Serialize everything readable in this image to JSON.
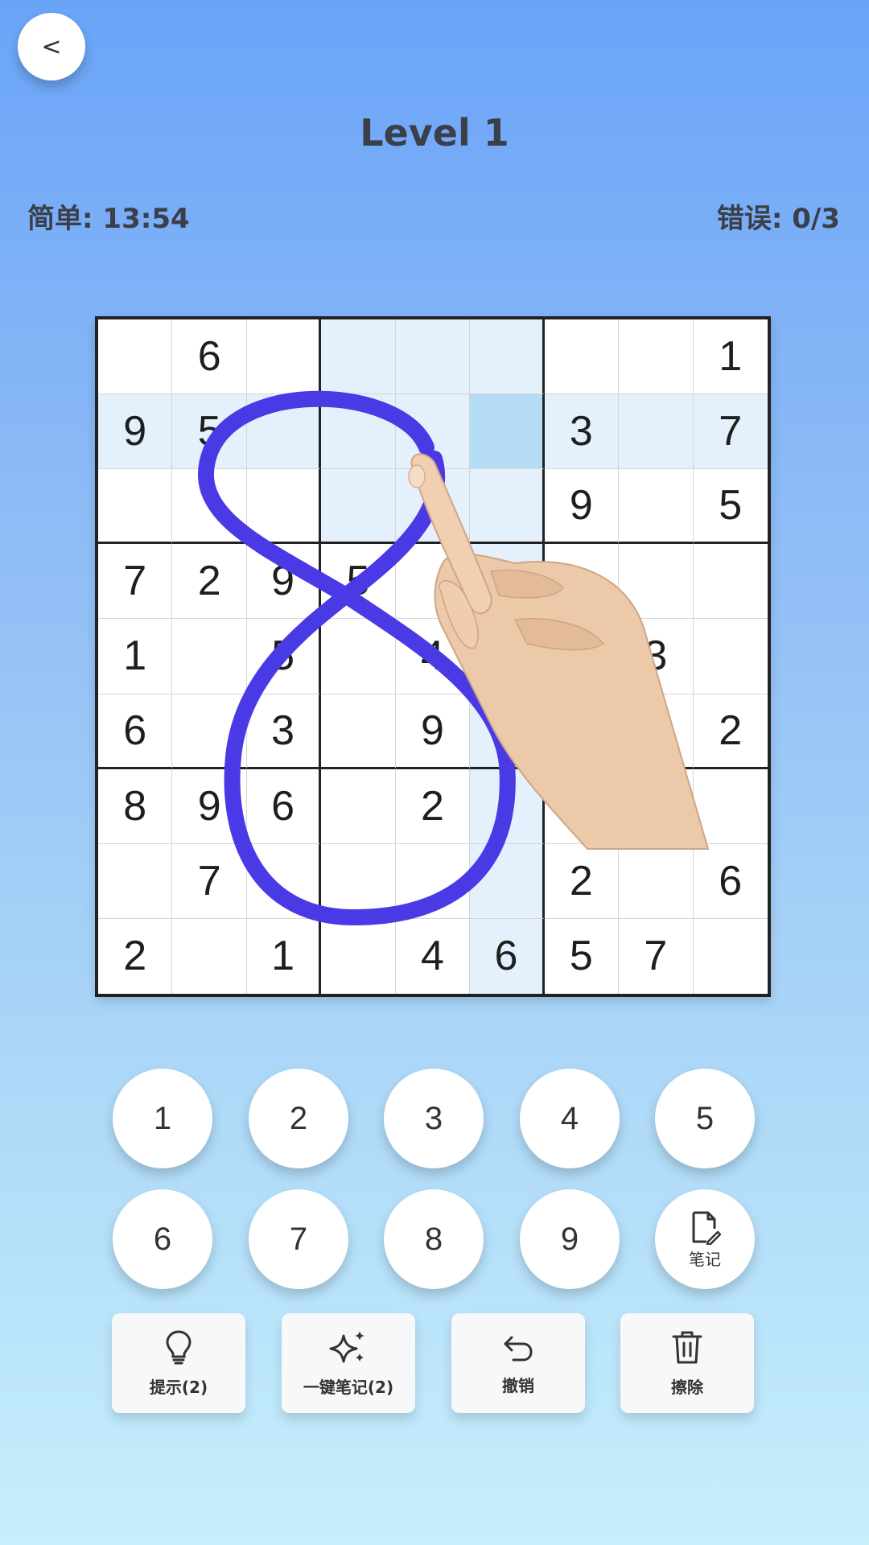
{
  "header": {
    "back_label": "<",
    "title": "Level 1",
    "difficulty_timer": "简单: 13:54",
    "errors": "错误: 0/3"
  },
  "board": {
    "rows": [
      [
        "",
        "6",
        "",
        "",
        "",
        "",
        "",
        "",
        "1"
      ],
      [
        "9",
        "5",
        "",
        "",
        "",
        "",
        "3",
        "",
        "7"
      ],
      [
        "",
        "",
        "",
        "",
        "",
        "",
        "9",
        "",
        "5"
      ],
      [
        "7",
        "2",
        "9",
        "5",
        "",
        "",
        "",
        "",
        ""
      ],
      [
        "1",
        "",
        "5",
        "",
        "4",
        "",
        "",
        "3",
        ""
      ],
      [
        "6",
        "",
        "3",
        "",
        "9",
        "",
        "",
        "",
        "2"
      ],
      [
        "8",
        "9",
        "6",
        "",
        "2",
        "",
        "",
        "",
        ""
      ],
      [
        "",
        "7",
        "",
        "",
        "",
        "",
        "2",
        "",
        "6"
      ],
      [
        "2",
        "",
        "1",
        "",
        "4",
        "6",
        "5",
        "7",
        ""
      ]
    ],
    "selected_cell": "row 2, column 6",
    "highlight_color": "#e5f0fd",
    "selected_color": "#b4dcf5"
  },
  "overlay": {
    "stroke_color": "#4a3ae6",
    "drawing": "figure-eight",
    "hand": "pointing-hand"
  },
  "numpad": {
    "numbers": [
      "1",
      "2",
      "3",
      "4",
      "5",
      "6",
      "7",
      "8",
      "9"
    ],
    "note_label": "笔记",
    "note_icon": "note-edit-icon"
  },
  "actions": [
    {
      "label": "提示(2)",
      "icon": "lightbulb-icon"
    },
    {
      "label": "一键笔记(2)",
      "icon": "sparkles-icon"
    },
    {
      "label": "撤销",
      "icon": "undo-icon"
    },
    {
      "label": "擦除",
      "icon": "trash-icon"
    }
  ]
}
